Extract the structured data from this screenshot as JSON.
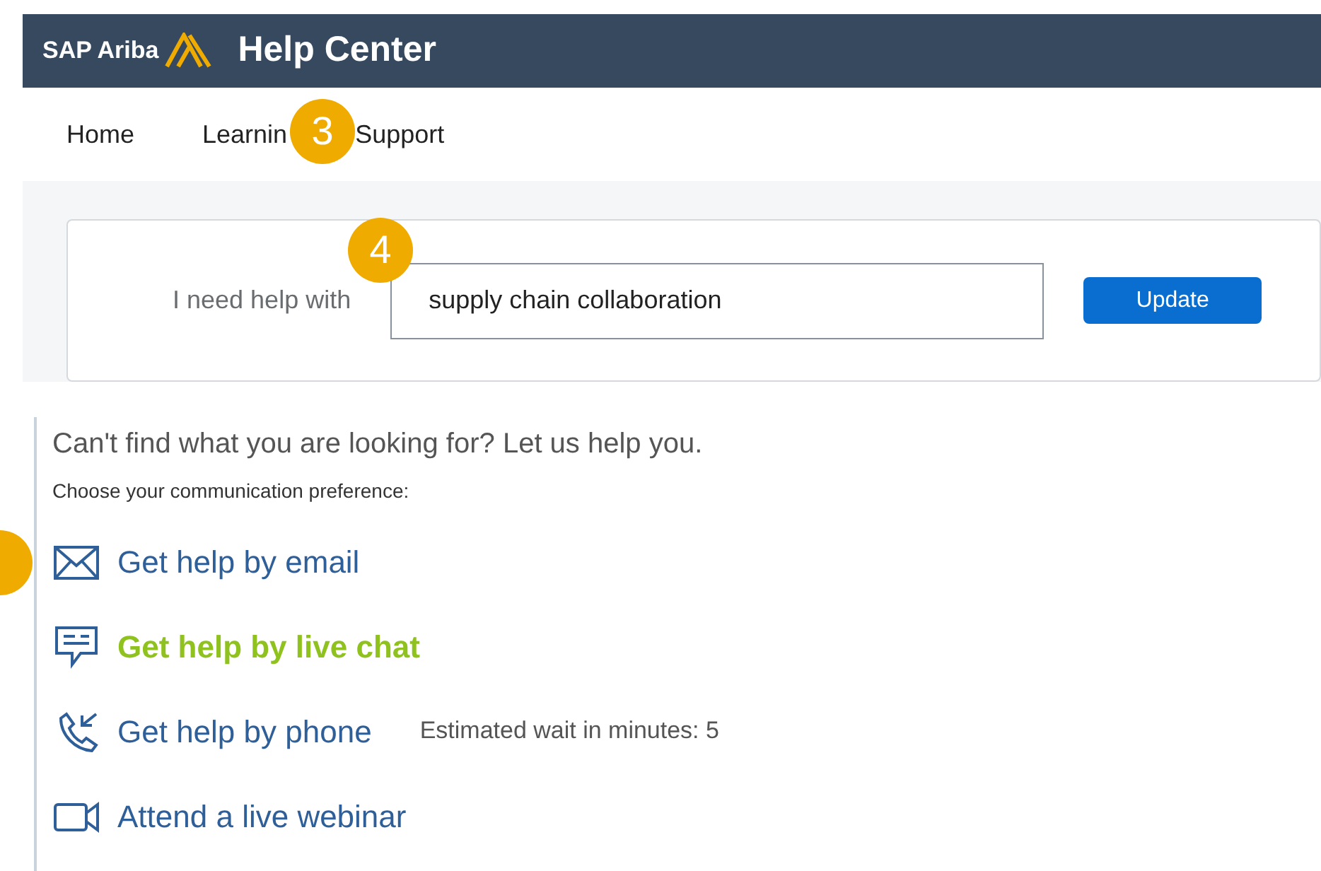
{
  "header": {
    "brand": "SAP Ariba",
    "title": "Help Center"
  },
  "nav": [
    {
      "label": "Home"
    },
    {
      "label": "Learnin",
      "callout": "3"
    },
    {
      "label": "Support"
    }
  ],
  "search": {
    "label": "I need help with",
    "callout": "4",
    "value": "supply chain collaboration",
    "button": "Update"
  },
  "help": {
    "heading": "Can't find what you are looking for? Let us help you.",
    "subheading": "Choose your communication preference:",
    "options": [
      {
        "kind": "email",
        "label": "Get help by email",
        "selected": false,
        "callout": true
      },
      {
        "kind": "chat",
        "label": "Get help by live chat",
        "selected": true
      },
      {
        "kind": "phone",
        "label": "Get help by phone",
        "selected": false,
        "note": "Estimated wait in minutes: 5"
      },
      {
        "kind": "webinar",
        "label": "Attend a live webinar",
        "selected": false
      }
    ]
  }
}
